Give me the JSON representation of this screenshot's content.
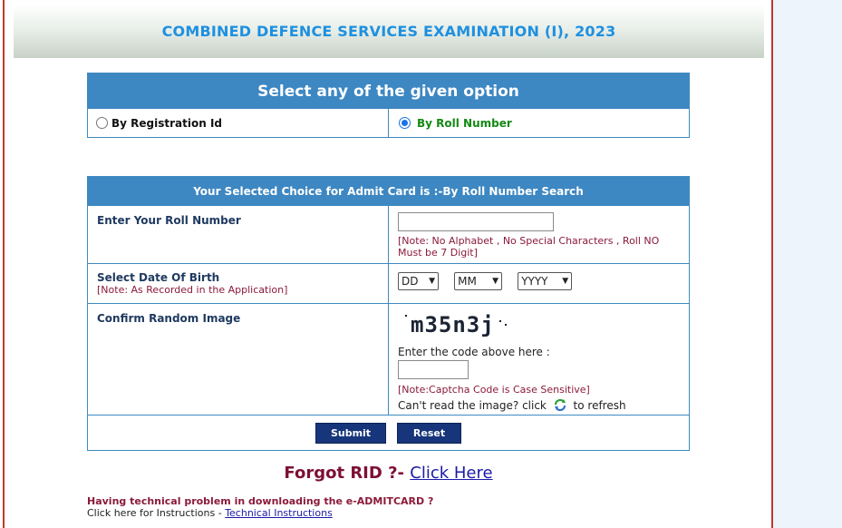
{
  "header": {
    "title": "COMBINED DEFENCE SERVICES EXAMINATION (I), 2023"
  },
  "options": {
    "heading": "Select any of the given option",
    "by_registration_label": "By Registration Id",
    "by_roll_label": "By Roll Number",
    "selected": "By Roll Number"
  },
  "form": {
    "heading": "Your Selected Choice for Admit Card is :-By Roll Number Search",
    "roll": {
      "label": "Enter Your Roll Number",
      "value": "",
      "note": "[Note: No Alphabet , No Special Characters , Roll NO Must be 7 Digit]"
    },
    "dob": {
      "label": "Select Date Of Birth",
      "note": "[Note: As Recorded in the Application]",
      "day": "DD",
      "month": "MM",
      "year": "YYYY"
    },
    "captcha": {
      "label": "Confirm Random Image",
      "image_text": "m35n3j",
      "prompt": "Enter the code above here :",
      "value": "",
      "note": "[Note:Captcha Code is Case Sensitive]",
      "refresh_prefix": "Can't read the image? click",
      "refresh_suffix": "to refresh",
      "refresh_icon": "refresh-icon"
    },
    "submit_label": "Submit",
    "reset_label": "Reset"
  },
  "forgot": {
    "text": "Forgot RID ?-",
    "link": "Click Here"
  },
  "help": {
    "question": "Having technical problem in downloading the e-ADMITCARD ?",
    "prefix": "Click here for Instructions -",
    "link": "Technical Instructions"
  },
  "colors": {
    "header_text": "#1e90e0",
    "table_header": "#3d87c2",
    "button": "#17357a",
    "note": "#8b1a3a",
    "link": "#1a1aa8",
    "accent_red": "#c0392b"
  }
}
